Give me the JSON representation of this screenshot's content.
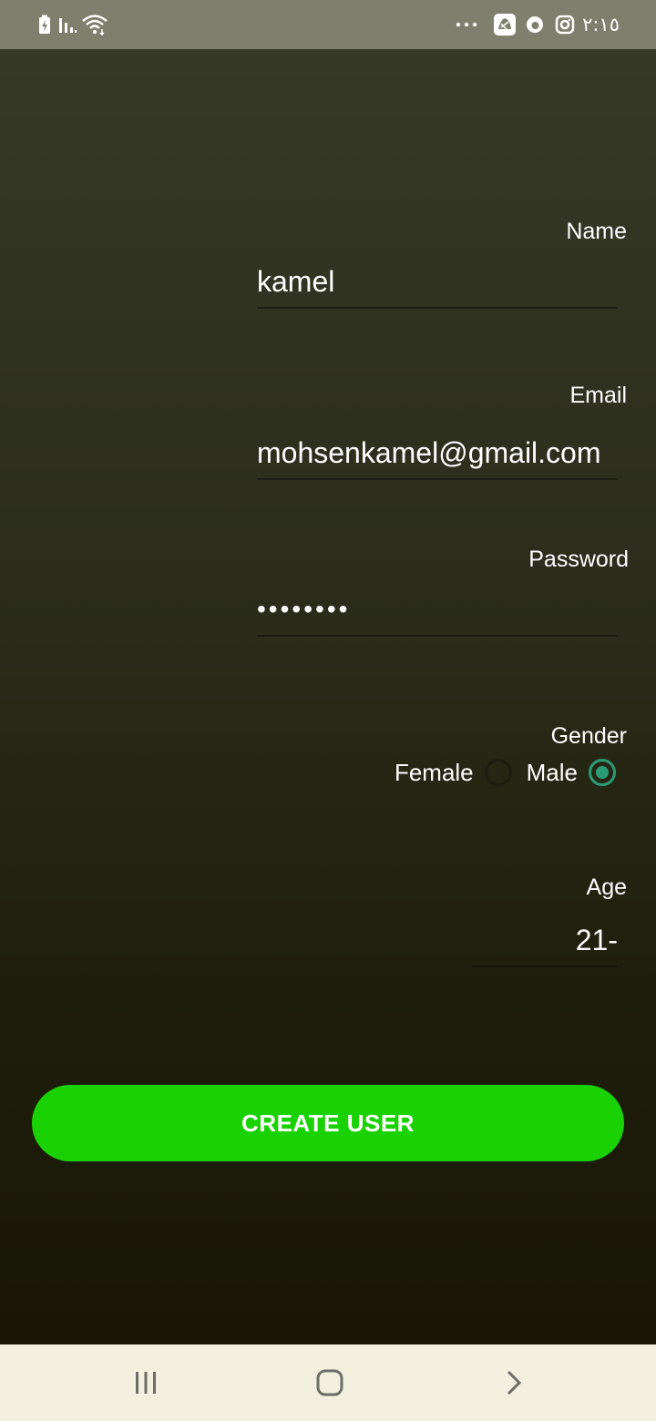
{
  "status_bar": {
    "time": "٢:١٥",
    "left_icons": [
      "battery-charging-icon",
      "signal-icon",
      "wifi-icon"
    ],
    "right_icons": [
      "more-dots-icon",
      "app-notification-icon",
      "vodafone-icon",
      "instagram-icon"
    ]
  },
  "form": {
    "name": {
      "label": "Name",
      "value": "kamel"
    },
    "email": {
      "label": "Email",
      "value": "mohsenkamel@gmail.com"
    },
    "password": {
      "label": "Password",
      "value": "••••••••"
    },
    "gender": {
      "label": "Gender",
      "options": [
        {
          "label": "Female",
          "checked": false
        },
        {
          "label": "Male",
          "checked": true
        }
      ]
    },
    "age": {
      "label": "Age",
      "value": "21-"
    }
  },
  "create_button": {
    "label": "CREATE USER"
  },
  "colors": {
    "accent_green": "#1ad103",
    "radio_checked": "#2a9d76",
    "status_bar": "#7e7f6c",
    "nav_bar": "#f3f0df"
  },
  "nav_bar": {
    "buttons": [
      "recents-icon",
      "home-icon",
      "back-icon"
    ]
  }
}
